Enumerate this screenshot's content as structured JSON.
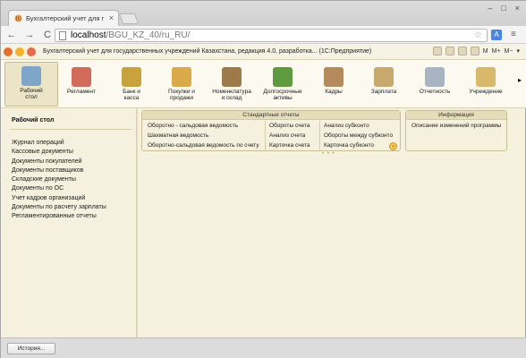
{
  "browser": {
    "tab_title": "Бухгалтерский учет для г",
    "tab_close": "×",
    "window_controls": [
      "–",
      "□",
      "×"
    ],
    "url_host": "localhost",
    "url_path": "/BGU_KZ_40/ru_RU/",
    "back": "←",
    "forward": "→",
    "reload": "C",
    "star": "☆",
    "translate_label": "A",
    "menu": "≡"
  },
  "app": {
    "title": "Бухгалтерский учет для государственных учреждений Казахстана, редакция 4.0, разработка... (1С:Предприятие)",
    "actions": [
      "M",
      "M+",
      "M−"
    ],
    "caret": "▾"
  },
  "sections": [
    {
      "label": "Рабочий\nстол",
      "icon": "desktop-icon",
      "color": "#7ea6c9",
      "active": true
    },
    {
      "label": "Регламент",
      "icon": "regulation-icon",
      "color": "#d36b5a",
      "active": false
    },
    {
      "label": "Банк и\nкасса",
      "icon": "bank-icon",
      "color": "#c8a23c",
      "active": false
    },
    {
      "label": "Покупки и\nпродажи",
      "icon": "purchase-icon",
      "color": "#d9a94a",
      "active": false
    },
    {
      "label": "Номенклатура\nи склад",
      "icon": "warehouse-icon",
      "color": "#9d7a4a",
      "active": false
    },
    {
      "label": "Долгосрочные\nактивы",
      "icon": "assets-icon",
      "color": "#5e9a3e",
      "active": false
    },
    {
      "label": "Кадры",
      "icon": "staff-icon",
      "color": "#b58a5c",
      "active": false
    },
    {
      "label": "Зарплата",
      "icon": "salary-icon",
      "color": "#c6a96d",
      "active": false
    },
    {
      "label": "Отчетность",
      "icon": "reports-icon",
      "color": "#a9b4c2",
      "active": false
    },
    {
      "label": "Учреждение",
      "icon": "institution-icon",
      "color": "#d8b96a",
      "active": false
    }
  ],
  "sections_scroll": "▸",
  "left_panel": {
    "title": "Рабочий стол",
    "items": [
      "Журнал операций",
      "Кассовые документы",
      "Документы покупателей",
      "Документы поставщиков",
      "Складские документы",
      "Документы по ОС",
      "Учет кадров организаций",
      "Документы по расчету зарплаты",
      "Регламентированные отчеты"
    ]
  },
  "reports_group": {
    "title": "Стандартные отчеты",
    "col1": [
      "Оборотно - сальдовая ведомость",
      "Шахматная ведомость",
      "Оборотно-сальдовая ведомость по счету"
    ],
    "col2": [
      "Обороты счета",
      "Анализ счета",
      "Карточка счета"
    ],
    "col3": [
      "Анализ субконто",
      "Обороты между субконто",
      "Карточка субконто"
    ],
    "more": "⌄",
    "dots": "• • •"
  },
  "info_group": {
    "title": "Информация",
    "items": [
      "Описание изменений программы"
    ]
  },
  "footer": {
    "history_button": "История..."
  }
}
